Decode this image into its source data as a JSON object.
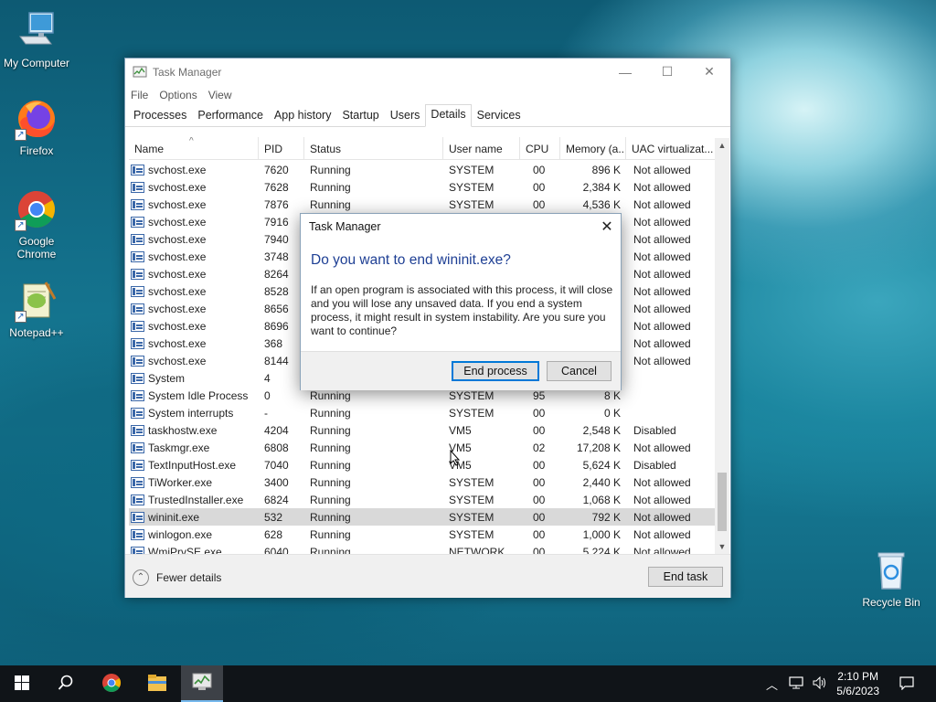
{
  "desktop": {
    "icons": [
      {
        "label": "My Computer",
        "icon": "computer-icon"
      },
      {
        "label": "Firefox",
        "icon": "firefox-icon"
      },
      {
        "label": "Google Chrome",
        "icon": "chrome-icon"
      },
      {
        "label": "Notepad++",
        "icon": "notepadpp-icon"
      },
      {
        "label": "Recycle Bin",
        "icon": "recycle-bin-icon"
      }
    ]
  },
  "taskmanager": {
    "title": "Task Manager",
    "menu": [
      "File",
      "Options",
      "View"
    ],
    "tabs": [
      "Processes",
      "Performance",
      "App history",
      "Startup",
      "Users",
      "Details",
      "Services"
    ],
    "active_tab": "Details",
    "columns": [
      "Name",
      "PID",
      "Status",
      "User name",
      "CPU",
      "Memory (a...",
      "UAC virtualizat..."
    ],
    "rows": [
      {
        "name": "svchost.exe",
        "pid": "7620",
        "status": "Running",
        "user": "SYSTEM",
        "cpu": "00",
        "mem": "896 K",
        "uac": "Not allowed"
      },
      {
        "name": "svchost.exe",
        "pid": "7628",
        "status": "Running",
        "user": "SYSTEM",
        "cpu": "00",
        "mem": "2,384 K",
        "uac": "Not allowed"
      },
      {
        "name": "svchost.exe",
        "pid": "7876",
        "status": "Running",
        "user": "SYSTEM",
        "cpu": "00",
        "mem": "4,536 K",
        "uac": "Not allowed"
      },
      {
        "name": "svchost.exe",
        "pid": "7916",
        "status": "",
        "user": "",
        "cpu": "",
        "mem": "",
        "uac": "Not allowed"
      },
      {
        "name": "svchost.exe",
        "pid": "7940",
        "status": "",
        "user": "",
        "cpu": "",
        "mem": "",
        "uac": "Not allowed"
      },
      {
        "name": "svchost.exe",
        "pid": "3748",
        "status": "",
        "user": "",
        "cpu": "",
        "mem": "",
        "uac": "Not allowed"
      },
      {
        "name": "svchost.exe",
        "pid": "8264",
        "status": "",
        "user": "",
        "cpu": "",
        "mem": "",
        "uac": "Not allowed"
      },
      {
        "name": "svchost.exe",
        "pid": "8528",
        "status": "",
        "user": "",
        "cpu": "",
        "mem": "",
        "uac": "Not allowed"
      },
      {
        "name": "svchost.exe",
        "pid": "8656",
        "status": "",
        "user": "",
        "cpu": "",
        "mem": "",
        "uac": "Not allowed"
      },
      {
        "name": "svchost.exe",
        "pid": "8696",
        "status": "",
        "user": "",
        "cpu": "",
        "mem": "",
        "uac": "Not allowed"
      },
      {
        "name": "svchost.exe",
        "pid": "368",
        "status": "",
        "user": "",
        "cpu": "",
        "mem": "",
        "uac": "Not allowed"
      },
      {
        "name": "svchost.exe",
        "pid": "8144",
        "status": "",
        "user": "",
        "cpu": "",
        "mem": "",
        "uac": "Not allowed"
      },
      {
        "name": "System",
        "pid": "4",
        "status": "",
        "user": "",
        "cpu": "",
        "mem": "",
        "uac": ""
      },
      {
        "name": "System Idle Process",
        "pid": "0",
        "status": "Running",
        "user": "SYSTEM",
        "cpu": "95",
        "mem": "8 K",
        "uac": ""
      },
      {
        "name": "System interrupts",
        "pid": "-",
        "status": "Running",
        "user": "SYSTEM",
        "cpu": "00",
        "mem": "0 K",
        "uac": ""
      },
      {
        "name": "taskhostw.exe",
        "pid": "4204",
        "status": "Running",
        "user": "VM5",
        "cpu": "00",
        "mem": "2,548 K",
        "uac": "Disabled"
      },
      {
        "name": "Taskmgr.exe",
        "pid": "6808",
        "status": "Running",
        "user": "VM5",
        "cpu": "02",
        "mem": "17,208 K",
        "uac": "Not allowed"
      },
      {
        "name": "TextInputHost.exe",
        "pid": "7040",
        "status": "Running",
        "user": "VM5",
        "cpu": "00",
        "mem": "5,624 K",
        "uac": "Disabled"
      },
      {
        "name": "TiWorker.exe",
        "pid": "3400",
        "status": "Running",
        "user": "SYSTEM",
        "cpu": "00",
        "mem": "2,440 K",
        "uac": "Not allowed"
      },
      {
        "name": "TrustedInstaller.exe",
        "pid": "6824",
        "status": "Running",
        "user": "SYSTEM",
        "cpu": "00",
        "mem": "1,068 K",
        "uac": "Not allowed"
      },
      {
        "name": "wininit.exe",
        "pid": "532",
        "status": "Running",
        "user": "SYSTEM",
        "cpu": "00",
        "mem": "792 K",
        "uac": "Not allowed",
        "selected": true
      },
      {
        "name": "winlogon.exe",
        "pid": "628",
        "status": "Running",
        "user": "SYSTEM",
        "cpu": "00",
        "mem": "1,000 K",
        "uac": "Not allowed"
      },
      {
        "name": "WmiPrvSE.exe",
        "pid": "6040",
        "status": "Running",
        "user": "NETWORK ...",
        "cpu": "00",
        "mem": "5,224 K",
        "uac": "Not allowed"
      }
    ],
    "footer": {
      "fewer_details": "Fewer details",
      "end_task": "End task"
    }
  },
  "dialog": {
    "title": "Task Manager",
    "heading": "Do you want to end wininit.exe?",
    "body": "If an open program is associated with this process, it will close and you will lose any unsaved data. If you end a system process, it might result in system instability. Are you sure you want to continue?",
    "primary": "End process",
    "secondary": "Cancel"
  },
  "taskbar": {
    "time": "2:10 PM",
    "date": "5/6/2023",
    "items": [
      "start-icon",
      "search-icon",
      "chrome-icon",
      "file-explorer-icon",
      "task-manager-icon"
    ]
  }
}
